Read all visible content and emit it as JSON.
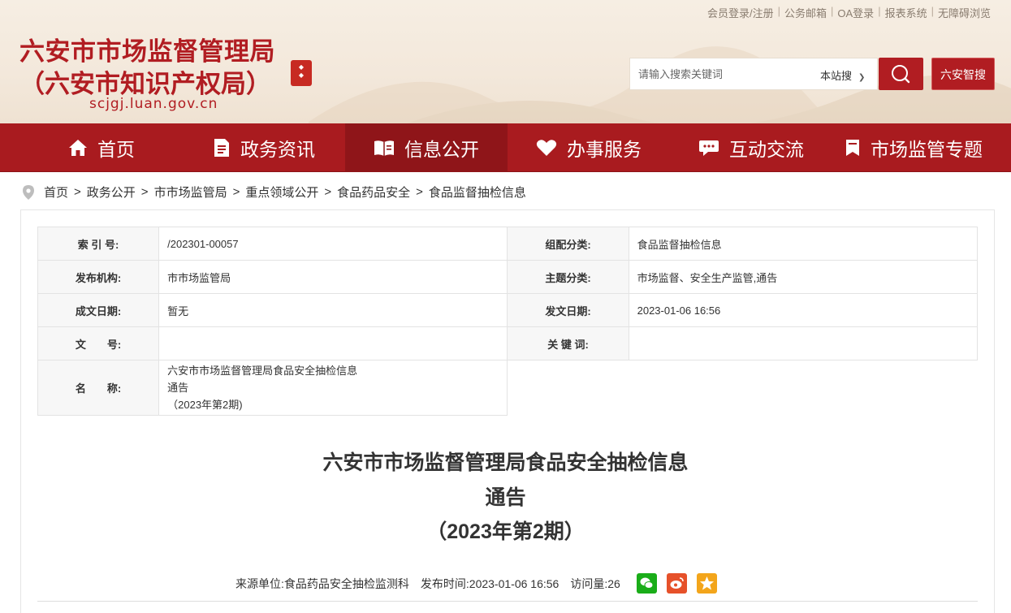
{
  "header": {
    "top_links": [
      "会员登录/注册",
      "公务邮箱",
      "OA登录",
      "报表系统",
      "无障碍浏览"
    ],
    "title_line1": "六安市市场监督管理局",
    "title_line2": "（六安市知识产权局）",
    "domain": "scjgj.luan.gov.cn",
    "search": {
      "placeholder": "请输入搜索关键词",
      "scope": "本站搜"
    },
    "zhisou_label": "六安智搜"
  },
  "nav": [
    {
      "label": "首页",
      "icon": "home-icon"
    },
    {
      "label": "政务资讯",
      "icon": "document-icon"
    },
    {
      "label": "信息公开",
      "icon": "open-book-icon"
    },
    {
      "label": "办事服务",
      "icon": "heart-icon"
    },
    {
      "label": "互动交流",
      "icon": "chat-icon"
    },
    {
      "label": "市场监管专题",
      "icon": "bookmark-icon"
    }
  ],
  "breadcrumb": [
    "首页",
    "政务公开",
    "市市场监管局",
    "重点领域公开",
    "食品药品安全",
    "食品监督抽检信息"
  ],
  "meta": {
    "index_label": "索 引 号:",
    "index_value": "/202301-00057",
    "category_label": "组配分类:",
    "category_value": "食品监督抽检信息",
    "publisher_label": "发布机构:",
    "publisher_value": "市市场监管局",
    "topic_label": "主题分类:",
    "topic_value": "市场监督、安全生产监管,通告",
    "created_label": "成文日期:",
    "created_value": "暂无",
    "issued_label": "发文日期:",
    "issued_value": "2023-01-06 16:56",
    "docno_label": "文　　号:",
    "docno_value": "",
    "keywords_label": "关 键 词:",
    "keywords_value": "",
    "name_label": "名　　称:",
    "name_lines": [
      "六安市市场监督管理局食品安全抽检信息",
      "通告",
      "（2023年第2期)"
    ]
  },
  "article": {
    "title_lines": [
      "六安市市场监督管理局食品安全抽检信息",
      "通告",
      "（2023年第2期）"
    ],
    "source_label": "来源单位:",
    "source_value": "食品药品安全抽检监测科",
    "time_label": "发布时间:",
    "time_value": "2023-01-06 16:56",
    "views_label": "访问量:",
    "views_value": "26",
    "share": [
      "wechat-icon",
      "weibo-icon",
      "favorite-icon"
    ]
  },
  "colors": {
    "brand": "#b11d22",
    "nav": "#a91b1f",
    "nav_active": "#8f1519",
    "wechat": "#1aad19",
    "weibo": "#e6512a",
    "favorite": "#f3a51b"
  }
}
